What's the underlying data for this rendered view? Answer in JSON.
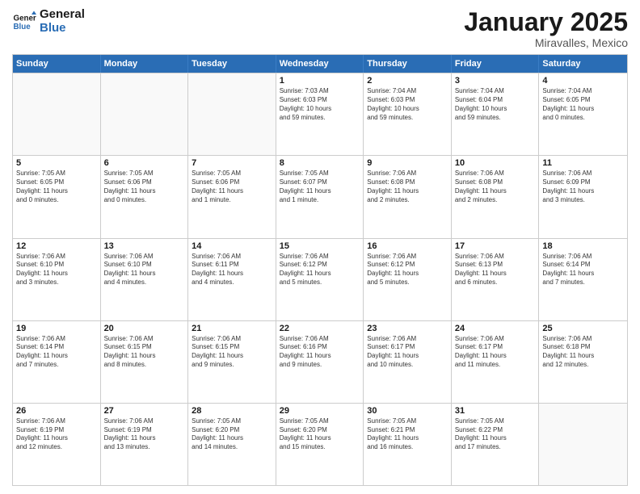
{
  "logo": {
    "line1": "General",
    "line2": "Blue"
  },
  "title": "January 2025",
  "subtitle": "Miravalles, Mexico",
  "days": [
    "Sunday",
    "Monday",
    "Tuesday",
    "Wednesday",
    "Thursday",
    "Friday",
    "Saturday"
  ],
  "weeks": [
    [
      {
        "day": "",
        "lines": []
      },
      {
        "day": "",
        "lines": []
      },
      {
        "day": "",
        "lines": []
      },
      {
        "day": "1",
        "lines": [
          "Sunrise: 7:03 AM",
          "Sunset: 6:03 PM",
          "Daylight: 10 hours",
          "and 59 minutes."
        ]
      },
      {
        "day": "2",
        "lines": [
          "Sunrise: 7:04 AM",
          "Sunset: 6:03 PM",
          "Daylight: 10 hours",
          "and 59 minutes."
        ]
      },
      {
        "day": "3",
        "lines": [
          "Sunrise: 7:04 AM",
          "Sunset: 6:04 PM",
          "Daylight: 10 hours",
          "and 59 minutes."
        ]
      },
      {
        "day": "4",
        "lines": [
          "Sunrise: 7:04 AM",
          "Sunset: 6:05 PM",
          "Daylight: 11 hours",
          "and 0 minutes."
        ]
      }
    ],
    [
      {
        "day": "5",
        "lines": [
          "Sunrise: 7:05 AM",
          "Sunset: 6:05 PM",
          "Daylight: 11 hours",
          "and 0 minutes."
        ]
      },
      {
        "day": "6",
        "lines": [
          "Sunrise: 7:05 AM",
          "Sunset: 6:06 PM",
          "Daylight: 11 hours",
          "and 0 minutes."
        ]
      },
      {
        "day": "7",
        "lines": [
          "Sunrise: 7:05 AM",
          "Sunset: 6:06 PM",
          "Daylight: 11 hours",
          "and 1 minute."
        ]
      },
      {
        "day": "8",
        "lines": [
          "Sunrise: 7:05 AM",
          "Sunset: 6:07 PM",
          "Daylight: 11 hours",
          "and 1 minute."
        ]
      },
      {
        "day": "9",
        "lines": [
          "Sunrise: 7:06 AM",
          "Sunset: 6:08 PM",
          "Daylight: 11 hours",
          "and 2 minutes."
        ]
      },
      {
        "day": "10",
        "lines": [
          "Sunrise: 7:06 AM",
          "Sunset: 6:08 PM",
          "Daylight: 11 hours",
          "and 2 minutes."
        ]
      },
      {
        "day": "11",
        "lines": [
          "Sunrise: 7:06 AM",
          "Sunset: 6:09 PM",
          "Daylight: 11 hours",
          "and 3 minutes."
        ]
      }
    ],
    [
      {
        "day": "12",
        "lines": [
          "Sunrise: 7:06 AM",
          "Sunset: 6:10 PM",
          "Daylight: 11 hours",
          "and 3 minutes."
        ]
      },
      {
        "day": "13",
        "lines": [
          "Sunrise: 7:06 AM",
          "Sunset: 6:10 PM",
          "Daylight: 11 hours",
          "and 4 minutes."
        ]
      },
      {
        "day": "14",
        "lines": [
          "Sunrise: 7:06 AM",
          "Sunset: 6:11 PM",
          "Daylight: 11 hours",
          "and 4 minutes."
        ]
      },
      {
        "day": "15",
        "lines": [
          "Sunrise: 7:06 AM",
          "Sunset: 6:12 PM",
          "Daylight: 11 hours",
          "and 5 minutes."
        ]
      },
      {
        "day": "16",
        "lines": [
          "Sunrise: 7:06 AM",
          "Sunset: 6:12 PM",
          "Daylight: 11 hours",
          "and 5 minutes."
        ]
      },
      {
        "day": "17",
        "lines": [
          "Sunrise: 7:06 AM",
          "Sunset: 6:13 PM",
          "Daylight: 11 hours",
          "and 6 minutes."
        ]
      },
      {
        "day": "18",
        "lines": [
          "Sunrise: 7:06 AM",
          "Sunset: 6:14 PM",
          "Daylight: 11 hours",
          "and 7 minutes."
        ]
      }
    ],
    [
      {
        "day": "19",
        "lines": [
          "Sunrise: 7:06 AM",
          "Sunset: 6:14 PM",
          "Daylight: 11 hours",
          "and 7 minutes."
        ]
      },
      {
        "day": "20",
        "lines": [
          "Sunrise: 7:06 AM",
          "Sunset: 6:15 PM",
          "Daylight: 11 hours",
          "and 8 minutes."
        ]
      },
      {
        "day": "21",
        "lines": [
          "Sunrise: 7:06 AM",
          "Sunset: 6:15 PM",
          "Daylight: 11 hours",
          "and 9 minutes."
        ]
      },
      {
        "day": "22",
        "lines": [
          "Sunrise: 7:06 AM",
          "Sunset: 6:16 PM",
          "Daylight: 11 hours",
          "and 9 minutes."
        ]
      },
      {
        "day": "23",
        "lines": [
          "Sunrise: 7:06 AM",
          "Sunset: 6:17 PM",
          "Daylight: 11 hours",
          "and 10 minutes."
        ]
      },
      {
        "day": "24",
        "lines": [
          "Sunrise: 7:06 AM",
          "Sunset: 6:17 PM",
          "Daylight: 11 hours",
          "and 11 minutes."
        ]
      },
      {
        "day": "25",
        "lines": [
          "Sunrise: 7:06 AM",
          "Sunset: 6:18 PM",
          "Daylight: 11 hours",
          "and 12 minutes."
        ]
      }
    ],
    [
      {
        "day": "26",
        "lines": [
          "Sunrise: 7:06 AM",
          "Sunset: 6:19 PM",
          "Daylight: 11 hours",
          "and 12 minutes."
        ]
      },
      {
        "day": "27",
        "lines": [
          "Sunrise: 7:06 AM",
          "Sunset: 6:19 PM",
          "Daylight: 11 hours",
          "and 13 minutes."
        ]
      },
      {
        "day": "28",
        "lines": [
          "Sunrise: 7:05 AM",
          "Sunset: 6:20 PM",
          "Daylight: 11 hours",
          "and 14 minutes."
        ]
      },
      {
        "day": "29",
        "lines": [
          "Sunrise: 7:05 AM",
          "Sunset: 6:20 PM",
          "Daylight: 11 hours",
          "and 15 minutes."
        ]
      },
      {
        "day": "30",
        "lines": [
          "Sunrise: 7:05 AM",
          "Sunset: 6:21 PM",
          "Daylight: 11 hours",
          "and 16 minutes."
        ]
      },
      {
        "day": "31",
        "lines": [
          "Sunrise: 7:05 AM",
          "Sunset: 6:22 PM",
          "Daylight: 11 hours",
          "and 17 minutes."
        ]
      },
      {
        "day": "",
        "lines": []
      }
    ]
  ]
}
